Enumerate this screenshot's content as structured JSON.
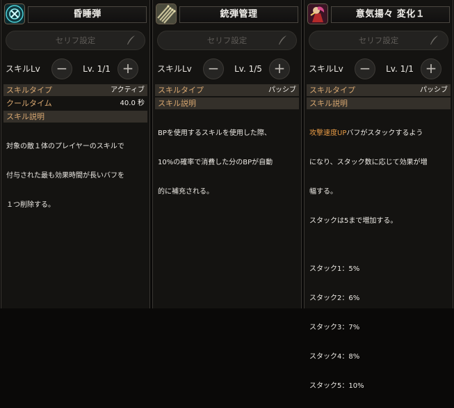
{
  "cards": [
    {
      "title": "昏睡弾",
      "icon": "sleep-bullet-icon",
      "serif_label": "セリフ設定",
      "lv_label": "スキルLv",
      "lv_value": "Lv. 1/1",
      "minus": "−",
      "plus": "+",
      "type_key": "スキルタイプ",
      "type_value": "アクティブ",
      "cooldown_key": "クールタイム",
      "cooldown_value": "40.0 秒",
      "desc_key": "スキル説明",
      "desc_lines": [
        "対象の敵１体のプレイヤーのスキルで",
        "付与された最も効果時間が長いバフを",
        "１つ削除する。"
      ]
    },
    {
      "title": "銃弾管理",
      "icon": "bullets-icon",
      "serif_label": "セリフ設定",
      "lv_label": "スキルLv",
      "lv_value": "Lv. 1/5",
      "minus": "−",
      "plus": "+",
      "type_key": "スキルタイプ",
      "type_value": "パッシブ",
      "desc_key": "スキル説明",
      "desc_lines": [
        "BPを使用するスキルを使用した際、",
        "10%の確率で消費した分のBPが自動",
        "的に補充される。"
      ]
    },
    {
      "title": "意気揚々 変化１",
      "icon": "high-spirits-icon",
      "serif_label": "セリフ設定",
      "lv_label": "スキルLv",
      "lv_value": "Lv. 1/1",
      "minus": "−",
      "plus": "+",
      "type_key": "スキルタイプ",
      "type_value": "パッシブ",
      "desc_key": "スキル説明",
      "desc_highlight": "攻撃速度UP",
      "desc_first_rest": "バフがスタックするよう",
      "desc_lines": [
        "になり、スタック数に応じて効果が増",
        "幅する。",
        "スタックは5まで増加する。"
      ],
      "stacks": [
        "スタック1：5%",
        "スタック2：6%",
        "スタック3：7%",
        "スタック4：8%",
        "スタック5：10%"
      ],
      "highlight_color": "#e69a45"
    }
  ]
}
